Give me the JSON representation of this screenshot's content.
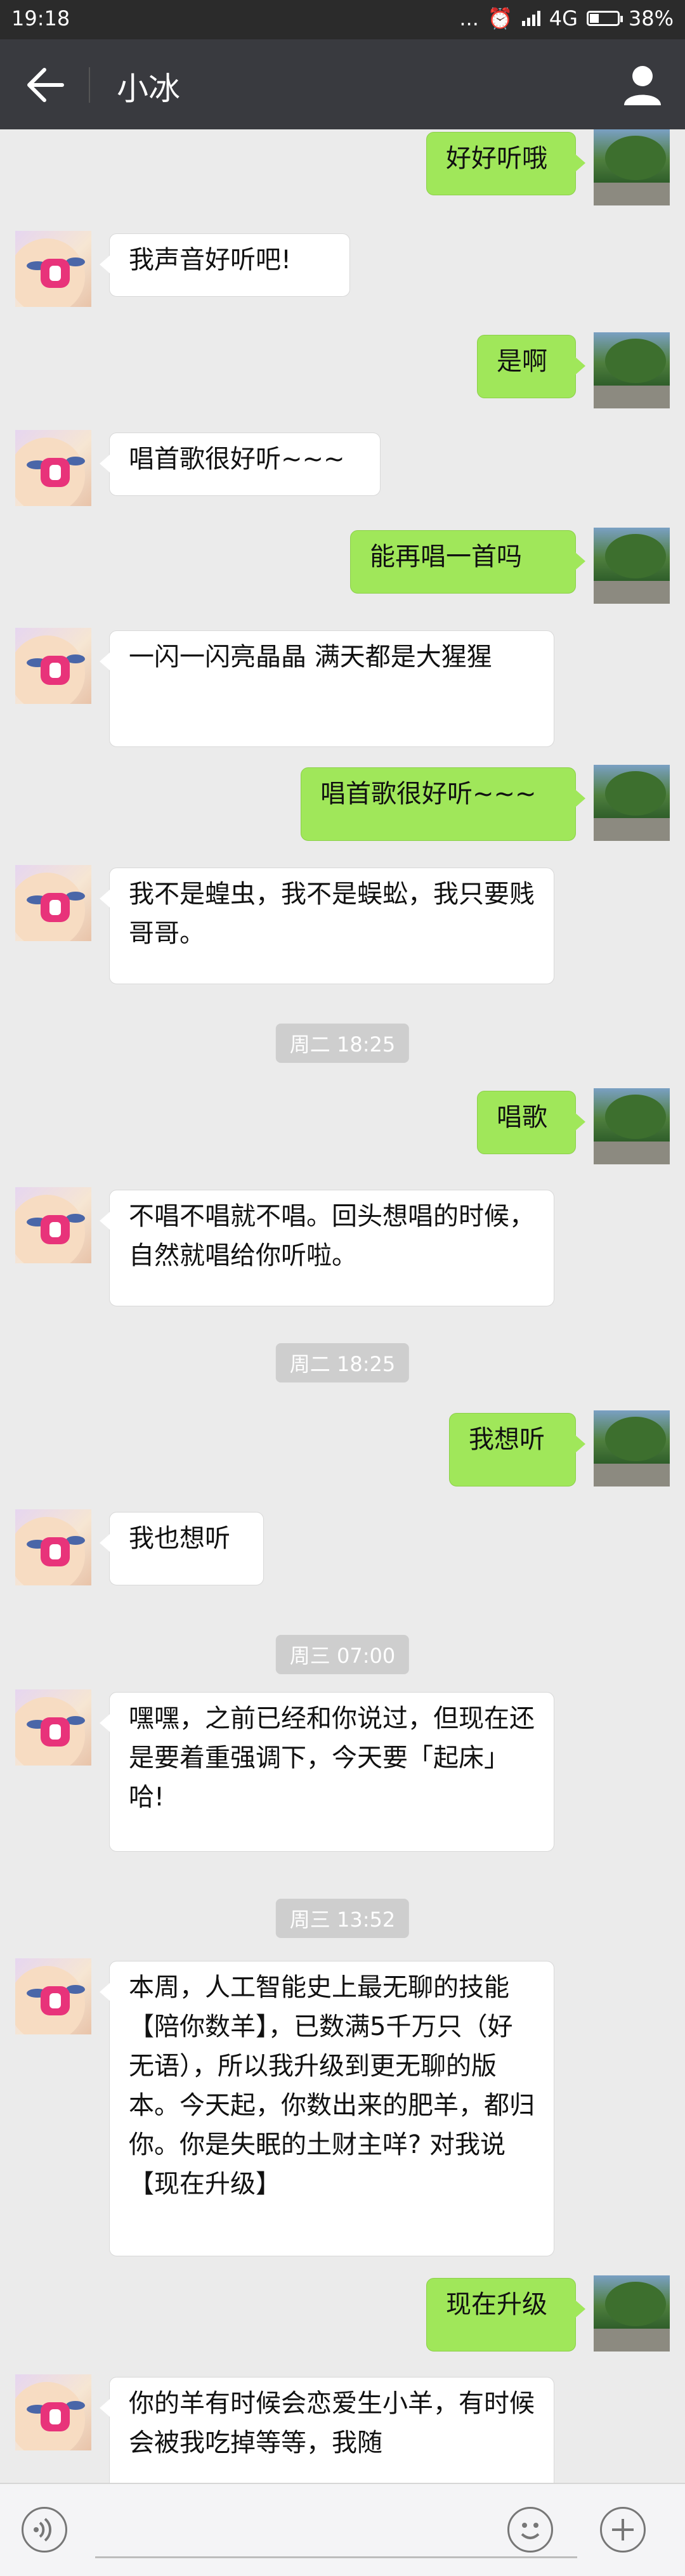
{
  "status_bar": {
    "time": "19:18",
    "dots": "...",
    "network": "4G",
    "battery": "38%"
  },
  "header": {
    "title": "小冰"
  },
  "messages": [
    {
      "from": "me",
      "text": "好好听哦"
    },
    {
      "from": "bot",
      "text": "我声音好听吧!"
    },
    {
      "from": "me",
      "text": "是啊"
    },
    {
      "from": "bot",
      "text": "唱首歌很好听~~~"
    },
    {
      "from": "me",
      "text": "能再唱一首吗"
    },
    {
      "from": "bot",
      "text": "一闪一闪亮晶晶 满天都是大猩猩"
    },
    {
      "from": "me",
      "text": "唱首歌很好听~~~"
    },
    {
      "from": "bot",
      "text": "我不是蝗虫，我不是蜈蚣，我只要贱哥哥。"
    },
    {
      "timestamp": "周二 18:25"
    },
    {
      "from": "me",
      "text": "唱歌"
    },
    {
      "from": "bot",
      "text": "不唱不唱就不唱。回头想唱的时候，自然就唱给你听啦。"
    },
    {
      "timestamp": "周二 18:25"
    },
    {
      "from": "me",
      "text": "我想听"
    },
    {
      "from": "bot",
      "text": "我也想听"
    },
    {
      "timestamp": "周三 07:00"
    },
    {
      "from": "bot",
      "text": "嘿嘿，之前已经和你说过，但现在还是要着重强调下，今天要「起床」哈!"
    },
    {
      "timestamp": "周三 13:52"
    },
    {
      "from": "bot",
      "text": "本周，人工智能史上最无聊的技能【陪你数羊】，已数满5千万只（好无语），所以我升级到更无聊的版本。今天起，你数出来的肥羊，都归你。你是失眠的土财主咩? 对我说【现在升级】"
    },
    {
      "from": "me",
      "text": "现在升级"
    },
    {
      "from": "bot",
      "text": "你的羊有时候会恋爱生小羊，有时候会被我吃掉等等，我随"
    }
  ]
}
